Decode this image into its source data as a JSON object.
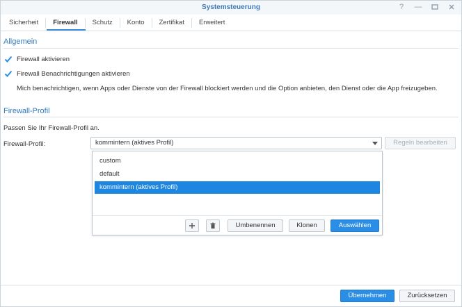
{
  "window": {
    "title": "Systemsteuerung",
    "controls": [
      "help-icon",
      "minimize-icon",
      "maximize-icon",
      "close-icon"
    ]
  },
  "tabs": [
    {
      "label": "Sicherheit",
      "active": false
    },
    {
      "label": "Firewall",
      "active": true
    },
    {
      "label": "Schutz",
      "active": false
    },
    {
      "label": "Konto",
      "active": false
    },
    {
      "label": "Zertifikat",
      "active": false
    },
    {
      "label": "Erweitert",
      "active": false
    }
  ],
  "general": {
    "title": "Allgemein",
    "enable_firewall": {
      "label": "Firewall aktivieren",
      "checked": true
    },
    "enable_notifications": {
      "label": "Firewall Benachrichtigungen aktivieren",
      "checked": true
    },
    "notification_desc": "Mich benachrichtigen, wenn Apps oder Dienste von der Firewall blockiert werden und die Option anbieten, den Dienst oder die App freizugeben."
  },
  "profile": {
    "title": "Firewall-Profil",
    "hint": "Passen Sie Ihr Firewall-Profil an.",
    "field_label": "Firewall-Profil:",
    "selected_value": "kommintern (aktives Profil)",
    "edit_rules_label": "Regeln bearbeiten",
    "options": [
      {
        "label": "custom",
        "selected": false
      },
      {
        "label": "default",
        "selected": false
      },
      {
        "label": "kommintern (aktives Profil)",
        "selected": true
      }
    ],
    "add_icon": "plus-icon",
    "delete_icon": "trash-icon",
    "rename_label": "Umbenennen",
    "clone_label": "Klonen",
    "select_label": "Auswählen"
  },
  "footer": {
    "apply_label": "Übernehmen",
    "reset_label": "Zurücksetzen"
  },
  "colors": {
    "accent": "#2b8ee6",
    "title": "#3d78b8",
    "section": "#2d7ac4",
    "selected_row": "#1d86e0"
  }
}
